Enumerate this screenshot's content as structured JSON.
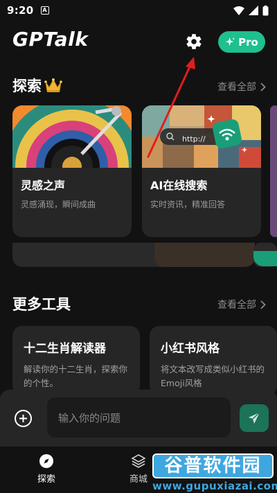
{
  "status_bar": {
    "time": "9:20",
    "notif_icon": "A"
  },
  "header": {
    "title": "GPTalk",
    "pro_label": "Pro"
  },
  "explore": {
    "title": "探索",
    "see_all": "查看全部",
    "cards": [
      {
        "title": "灵感之声",
        "desc": "灵感涌现，瞬间成曲"
      },
      {
        "title": "AI在线搜索",
        "desc": "实时资讯，精准回答",
        "url_text": "http://"
      }
    ]
  },
  "tools": {
    "title": "更多工具",
    "see_all": "查看全部",
    "cards": [
      {
        "title": "十二生肖解读器",
        "desc": "解读你的十二生肖，探索你的个性。"
      },
      {
        "title": "小红书风格",
        "desc": "将文本改写成类似小红书的Emoji风格"
      }
    ]
  },
  "input": {
    "placeholder": "输入你的问题"
  },
  "nav": [
    {
      "label": "探索"
    },
    {
      "label": "商城"
    }
  ],
  "watermark": {
    "brand": "谷普软件园",
    "domain": "www.gupuxiazai.com"
  },
  "colors": {
    "accent": "#1fbf8e",
    "background": "#121212",
    "card": "#262626",
    "annotation": "#e01e1e"
  }
}
